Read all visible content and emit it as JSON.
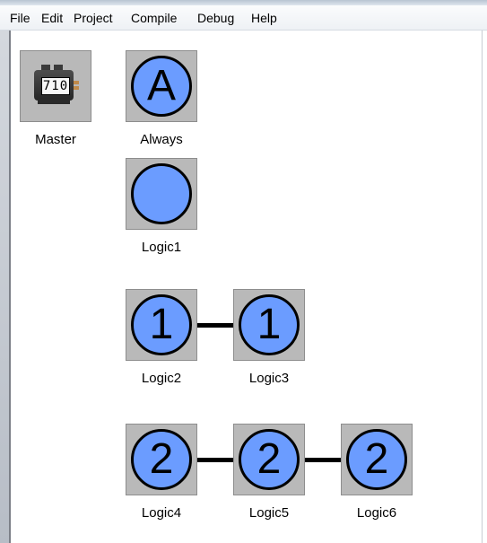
{
  "menu": [
    "File",
    "Edit",
    "Project",
    "Compile",
    "Debug",
    "Help"
  ],
  "master": {
    "display": "710",
    "label": "Master"
  },
  "nodes": {
    "always": {
      "glyph": "A",
      "label": "Always"
    },
    "logic1": {
      "glyph": "",
      "label": "Logic1"
    },
    "logic2": {
      "glyph": "1",
      "label": "Logic2"
    },
    "logic3": {
      "glyph": "1",
      "label": "Logic3"
    },
    "logic4": {
      "glyph": "2",
      "label": "Logic4"
    },
    "logic5": {
      "glyph": "2",
      "label": "Logic5"
    },
    "logic6": {
      "glyph": "2",
      "label": "Logic6"
    }
  },
  "colors": {
    "node_fill": "#6b9cff",
    "tile_bg": "#b9b9b9",
    "outline": "#000000"
  },
  "icons": {
    "master": "controller-module-icon"
  }
}
